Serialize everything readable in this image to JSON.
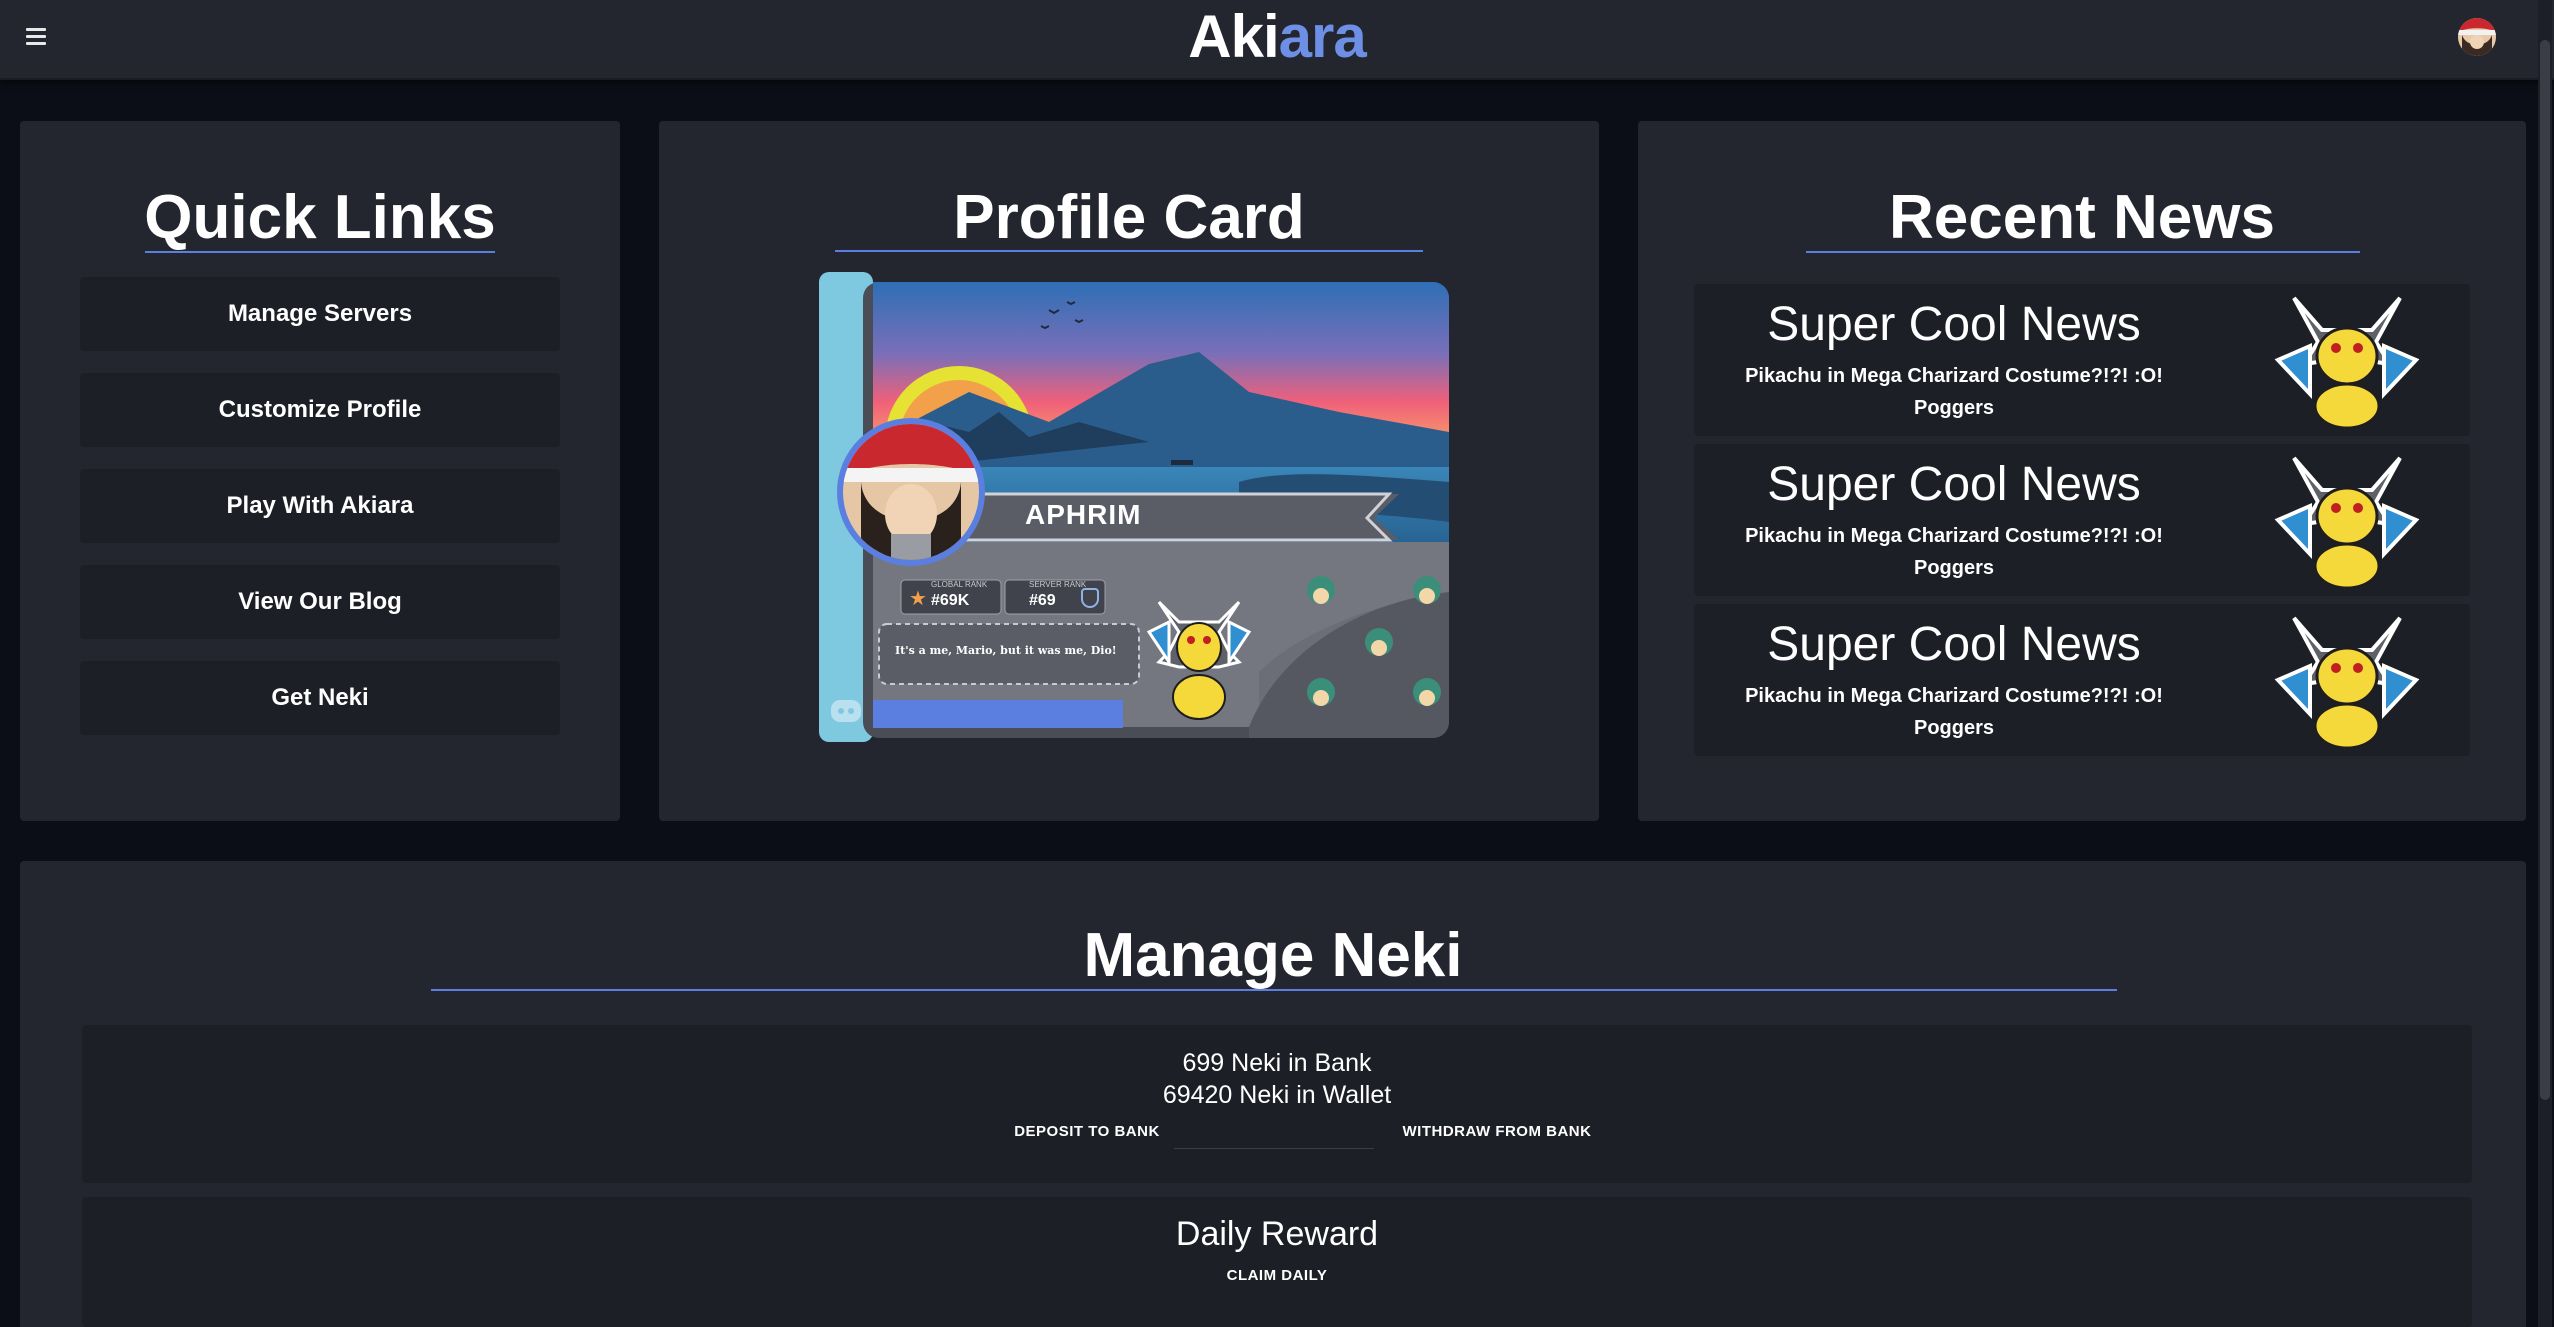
{
  "brand": {
    "part1": "Aki",
    "part2": "ara"
  },
  "quick_links": {
    "title": "Quick Links",
    "items": [
      "Manage Servers",
      "Customize Profile",
      "Play With Akiara",
      "View Our Blog",
      "Get Neki"
    ]
  },
  "profile_card": {
    "title": "Profile Card",
    "username": "APHRIM",
    "global_rank_label": "GLOBAL RANK",
    "global_rank": "#69K",
    "server_rank_label": "SERVER RANK",
    "server_rank": "#69",
    "quote": "It's a me, Mario, but it was me, Dio!"
  },
  "recent_news": {
    "title": "Recent News",
    "items": [
      {
        "title": "Super Cool News",
        "body_line1": "Pikachu in Mega Charizard Costume?!?! :O!",
        "body_line2": "Poggers"
      },
      {
        "title": "Super Cool News",
        "body_line1": "Pikachu in Mega Charizard Costume?!?! :O!",
        "body_line2": "Poggers"
      },
      {
        "title": "Super Cool News",
        "body_line1": "Pikachu in Mega Charizard Costume?!?! :O!",
        "body_line2": "Poggers"
      }
    ]
  },
  "manage_neki": {
    "title": "Manage Neki",
    "bank": "699 Neki in Bank",
    "wallet": "69420 Neki in Wallet",
    "deposit_label": "DEPOSIT TO BANK",
    "withdraw_label": "WITHDRAW FROM BANK",
    "amount_value": "",
    "daily_title": "Daily Reward",
    "claim_label": "CLAIM DAILY"
  },
  "colors": {
    "background": "#0b0e17",
    "panel": "#23262e",
    "inner": "#1c1f26",
    "accent": "#6d8fe6"
  },
  "icons": [
    "menu-icon",
    "user-avatar",
    "star-icon",
    "shield-icon",
    "discord-icon"
  ]
}
